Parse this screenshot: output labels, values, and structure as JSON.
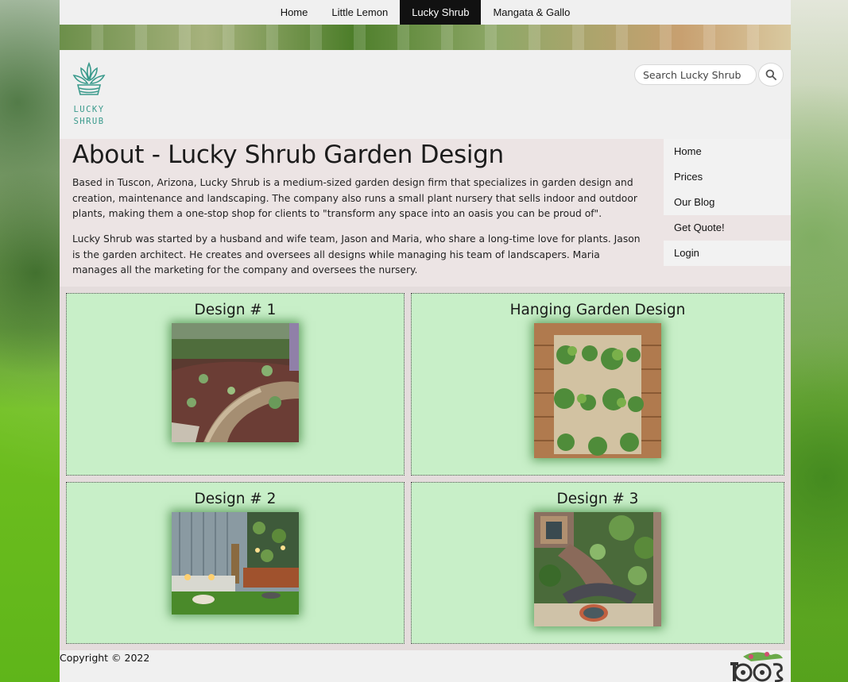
{
  "top_nav": {
    "items": [
      "Home",
      "Little Lemon",
      "Lucky Shrub",
      "Mangata & Gallo"
    ],
    "active": "Lucky Shrub"
  },
  "logo": {
    "text_line1": "LUCKY",
    "text_line2": "SHRUB"
  },
  "search": {
    "placeholder": "Search Lucky Shrub",
    "icon": "search-icon"
  },
  "about": {
    "title": "About - Lucky Shrub Garden Design",
    "paragraph1": "Based in Tuscon, Arizona, Lucky Shrub is a medium-sized garden design firm that specializes in garden design and creation, maintenance and landscaping. The company also runs a small plant nursery that sells indoor and outdoor plants, making them a one-stop shop for clients to \"transform any space into an oasis you can be proud of\".",
    "paragraph2": "Lucky Shrub was started by a husband and wife team, Jason and Maria, who share a long-time love for plants. Jason is the garden architect. He creates and oversees all designs while managing his team of landscapers. Maria manages all the marketing for the company and oversees the nursery."
  },
  "side_nav": {
    "items": [
      "Home",
      "Prices",
      "Our Blog",
      "Get Quote!",
      "Login"
    ]
  },
  "gallery": {
    "cards": [
      {
        "title": "Design # 1"
      },
      {
        "title": "Hanging Garden Design"
      },
      {
        "title": "Design # 2"
      },
      {
        "title": "Design # 3"
      }
    ]
  },
  "footer": {
    "copyright": "Copyright © 2022"
  },
  "colors": {
    "accent_teal": "#3a9a8c",
    "card_green": "#c8efc8",
    "about_bg": "#ece4e4",
    "active_nav": "#111111"
  }
}
